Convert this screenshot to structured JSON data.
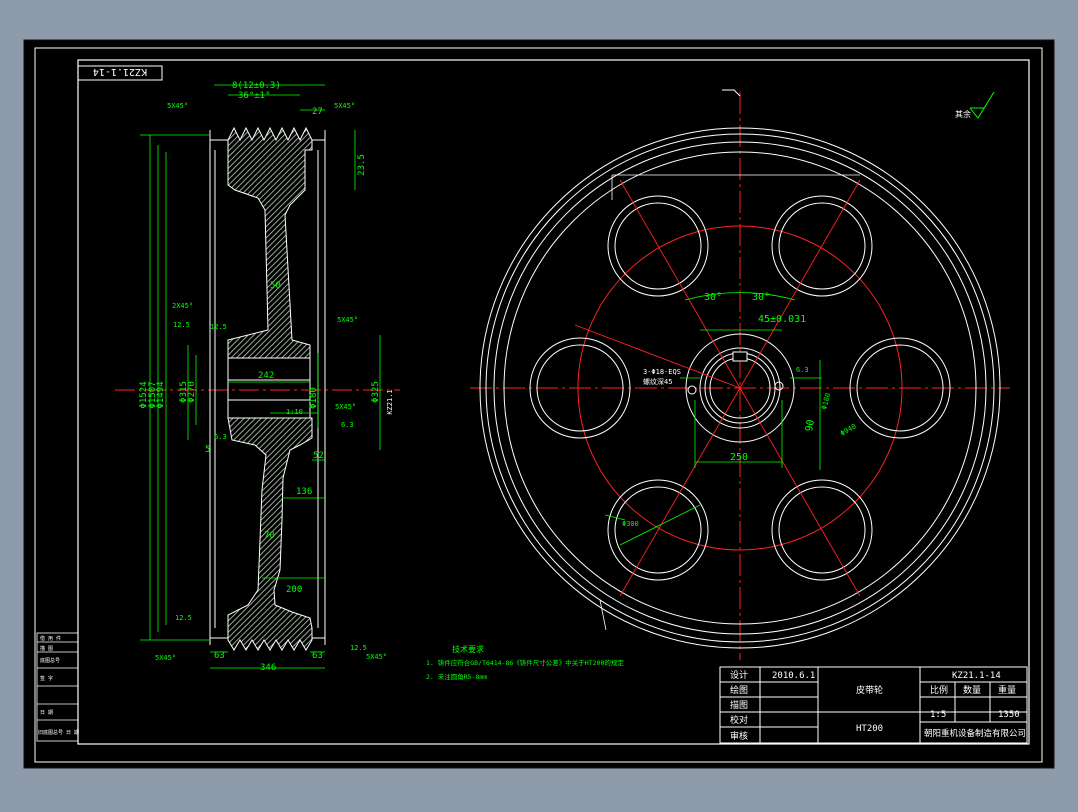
{
  "drawing": {
    "code_stamp": "KZ21.1-14",
    "roughness_note": "其余",
    "left_view": {
      "dims_top": [
        "8(12±0.3)",
        "36°±1°",
        "27"
      ],
      "chamfers": [
        "5X45°",
        "5X45°",
        "2X45°",
        "5X45°",
        "5X45°",
        "5X45°",
        "2X45°",
        "5X45°",
        "5X45°"
      ],
      "dia_outer": [
        "Φ1524",
        "Φ1507",
        "Φ1494"
      ],
      "dia_hub": [
        "Φ315",
        "Φ270"
      ],
      "dia_bore": "Φ180",
      "dia_right": "Φ325",
      "rib_width": "50",
      "len_242": "242",
      "len_52": "52",
      "len_136": "136",
      "len_70": "70",
      "len_200": "200",
      "len_63_left": "63",
      "len_346": "346",
      "len_63_right": "63",
      "len_235": "23.5",
      "len_5": "5",
      "ratio": "1:10",
      "roughness": [
        "12.5",
        "12.5",
        "6.3",
        "6.3",
        "12.5",
        "12.5"
      ],
      "top_63": "6.3",
      "side_tag": "KZ21.1"
    },
    "right_view": {
      "angle_left": "30°",
      "angle_right": "30°",
      "hole_spacing": "45±0.031",
      "bore_note_1": "3-Φ18-EQS",
      "bore_note_2": "螺纹深45",
      "dim_250": "250",
      "dim_940": "Φ940",
      "dim_90": "90",
      "dim_180_small": "Φ180",
      "dim_6_3": "6.3",
      "window_dia": "Φ300"
    },
    "tech_notes": {
      "title": "技术要求",
      "lines": [
        "1. 铸件应符合GB/T6414-86《铸件尺寸公差》中关于HT200的规定",
        "2. 未注圆角R5-8mm"
      ]
    },
    "title_block": {
      "rows": [
        {
          "label": "设计",
          "value": "2010.6.1"
        },
        {
          "label": "绘图",
          "value": ""
        },
        {
          "label": "描图",
          "value": ""
        },
        {
          "label": "校对",
          "value": ""
        },
        {
          "label": "审核",
          "value": ""
        }
      ],
      "part_name": "皮带轮",
      "material": "HT200",
      "drawing_no": "KZ21.1-14",
      "scale_label": "比例",
      "qty_label": "数量",
      "weight_label": "重量",
      "scale": "1:5",
      "weight": "1350",
      "company": "朝阳重机设备制造有限公司"
    },
    "side_table": {
      "rows": [
        "借 用 件",
        "描 图",
        "底图总号",
        "签 字",
        "日 期",
        "旧底图总号 日 期"
      ]
    }
  }
}
